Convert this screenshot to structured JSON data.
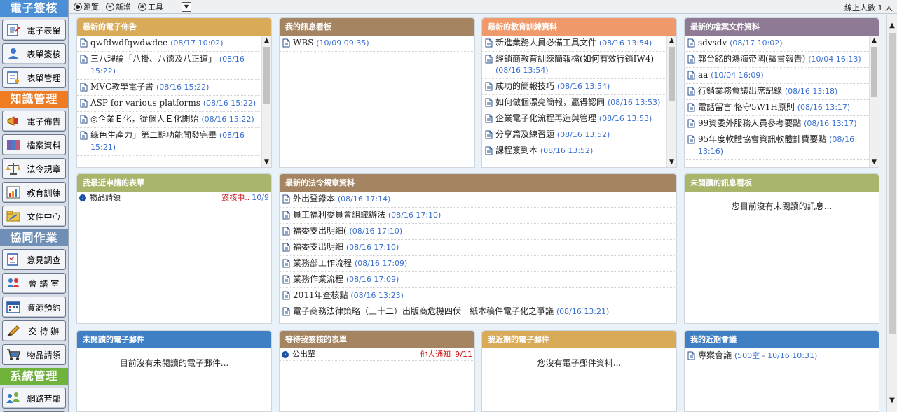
{
  "sidebar": {
    "sections": [
      {
        "title": "電子簽核",
        "items": [
          {
            "label": "電子表單",
            "icon": "form-icon"
          },
          {
            "label": "表單簽核",
            "icon": "approve-user-icon"
          },
          {
            "label": "表單管理",
            "icon": "form-manage-icon"
          }
        ]
      },
      {
        "title": "知識管理",
        "items": [
          {
            "label": "電子佈告",
            "icon": "announcement-icon"
          },
          {
            "label": "檔案資料",
            "icon": "archive-icon"
          },
          {
            "label": "法令規章",
            "icon": "law-scale-icon"
          },
          {
            "label": "教育訓練",
            "icon": "training-chart-icon"
          },
          {
            "label": "文件中心",
            "icon": "document-center-icon"
          }
        ]
      },
      {
        "title": "協同作業",
        "items": [
          {
            "label": "意見調查",
            "icon": "survey-icon"
          },
          {
            "label": "會 議 室",
            "icon": "meeting-room-icon"
          },
          {
            "label": "資源預約",
            "icon": "calendar-icon"
          },
          {
            "label": "交 待 辦",
            "icon": "task-pen-icon"
          },
          {
            "label": "物品請領",
            "icon": "cart-icon"
          }
        ]
      },
      {
        "title": "系統管理",
        "items": [
          {
            "label": "網路芳鄰",
            "icon": "network-icon"
          }
        ]
      }
    ]
  },
  "toolbar": {
    "browse": "瀏覽",
    "add": "新增",
    "tools": "工具",
    "online": "線上人數 1 人"
  },
  "panels": {
    "bulletin": {
      "title": "最新的電子佈告",
      "items": [
        {
          "text": "qwfdwdfqwdwdee",
          "date": "(08/17 10:02)"
        },
        {
          "text": "三八理論「八掛、八德及八正道」",
          "date": "(08/16 15:22)"
        },
        {
          "text": "MVC教學電子書",
          "date": "(08/16 15:22)"
        },
        {
          "text": "ASP for various platforms",
          "date": "(08/16 15:22)"
        },
        {
          "text": "◎企業Ｅ化，從個人Ｅ化開始",
          "date": "(08/16 15:22)"
        },
        {
          "text": "綠色生產力」第二期功能開發完畢",
          "date": "(08/16 15:21)"
        }
      ]
    },
    "messages": {
      "title": "我的訊息看板",
      "items": [
        {
          "text": "WBS",
          "date": "(10/09 09:35)"
        }
      ]
    },
    "training": {
      "title": "最新的教育訓練資料",
      "items": [
        {
          "text": "新進業務人員必備工具文件",
          "date": "(08/16 13:54)"
        },
        {
          "text": "經銷商教育訓練簡報檔(如何有效行銷IW4)",
          "date": "(08/16 13:54)"
        },
        {
          "text": "成功的簡報技巧",
          "date": "(08/16 13:54)"
        },
        {
          "text": "如何做個漂亮簡報，贏得認同",
          "date": "(08/16 13:53)"
        },
        {
          "text": "企業電子化流程再造與管理",
          "date": "(08/16 13:53)"
        },
        {
          "text": "分享篇及練習題",
          "date": "(08/16 13:52)"
        },
        {
          "text": "課程簽到本",
          "date": "(08/16 13:52)"
        }
      ]
    },
    "files": {
      "title": "最新的檔案文件資料",
      "items": [
        {
          "text": "sdvsdv",
          "date": "(08/17 10:02)"
        },
        {
          "text": "郭台銘的鴻海帝國(讀書報告)",
          "date": "(10/04 16:13)"
        },
        {
          "text": "aa",
          "date": "(10/04 16:09)"
        },
        {
          "text": "行銷業務會議出席記錄",
          "date": "(08/16 13:18)"
        },
        {
          "text": "電話留言 恪守5W1H原則",
          "date": "(08/16 13:17)"
        },
        {
          "text": "99資委外服務人員參考要點",
          "date": "(08/16 13:17)"
        },
        {
          "text": "95年度軟體協會資訊軟體計費要點",
          "date": "(08/16 13:16)"
        }
      ]
    },
    "myforms": {
      "title": "我最近申請的表單",
      "items": [
        {
          "text": "物品請領",
          "status": "簽核中..",
          "date": "10/9"
        }
      ]
    },
    "laws": {
      "title": "最新的法令規章資料",
      "items": [
        {
          "text": "外出登錄本",
          "date": "(08/16 17:14)"
        },
        {
          "text": "員工福利委員會組織辦法",
          "date": "(08/16 17:10)"
        },
        {
          "text": "福委支出明細(",
          "date": "(08/16 17:10)"
        },
        {
          "text": "福委支出明細",
          "date": "(08/16 17:10)"
        },
        {
          "text": "業務部工作流程",
          "date": "(08/16 17:09)"
        },
        {
          "text": "業務作業流程",
          "date": "(08/16 17:09)"
        },
        {
          "text": "2011年查核點",
          "date": "(08/16 13:23)"
        },
        {
          "text": "電子商務法律策略（三十二）出版商危機四伏　紙本稿件電子化之爭議",
          "date": "(08/16 13:21)"
        }
      ]
    },
    "unread_messages": {
      "title": "未閱讀的訊息看板",
      "empty": "您目前沒有未閱讀的訊息..."
    },
    "unread_mail": {
      "title": "未閱讀的電子郵件",
      "empty": "目前沒有未閱讀的電子郵件..."
    },
    "pending": {
      "title": "等待我簽核的表單",
      "items": [
        {
          "text": "公出單",
          "status": "他人通知",
          "date": "9/11"
        }
      ]
    },
    "recent_mail": {
      "title": "我近期的電子郵件",
      "empty": "您沒有電子郵件資料..."
    },
    "meetings": {
      "title": "我的近期會議",
      "items": [
        {
          "text": "專案會議",
          "date": "(500室 - 10/16 10:31)"
        }
      ]
    }
  },
  "colors": {
    "sidebar_head_blue": "#4b8fd6",
    "sidebar_head_orange": "#ef7b22",
    "sidebar_head_slate": "#6f8fb6",
    "sidebar_head_green": "#6fb23c",
    "date_blue": "#3a6fd0",
    "status_red": "#cc1111"
  }
}
